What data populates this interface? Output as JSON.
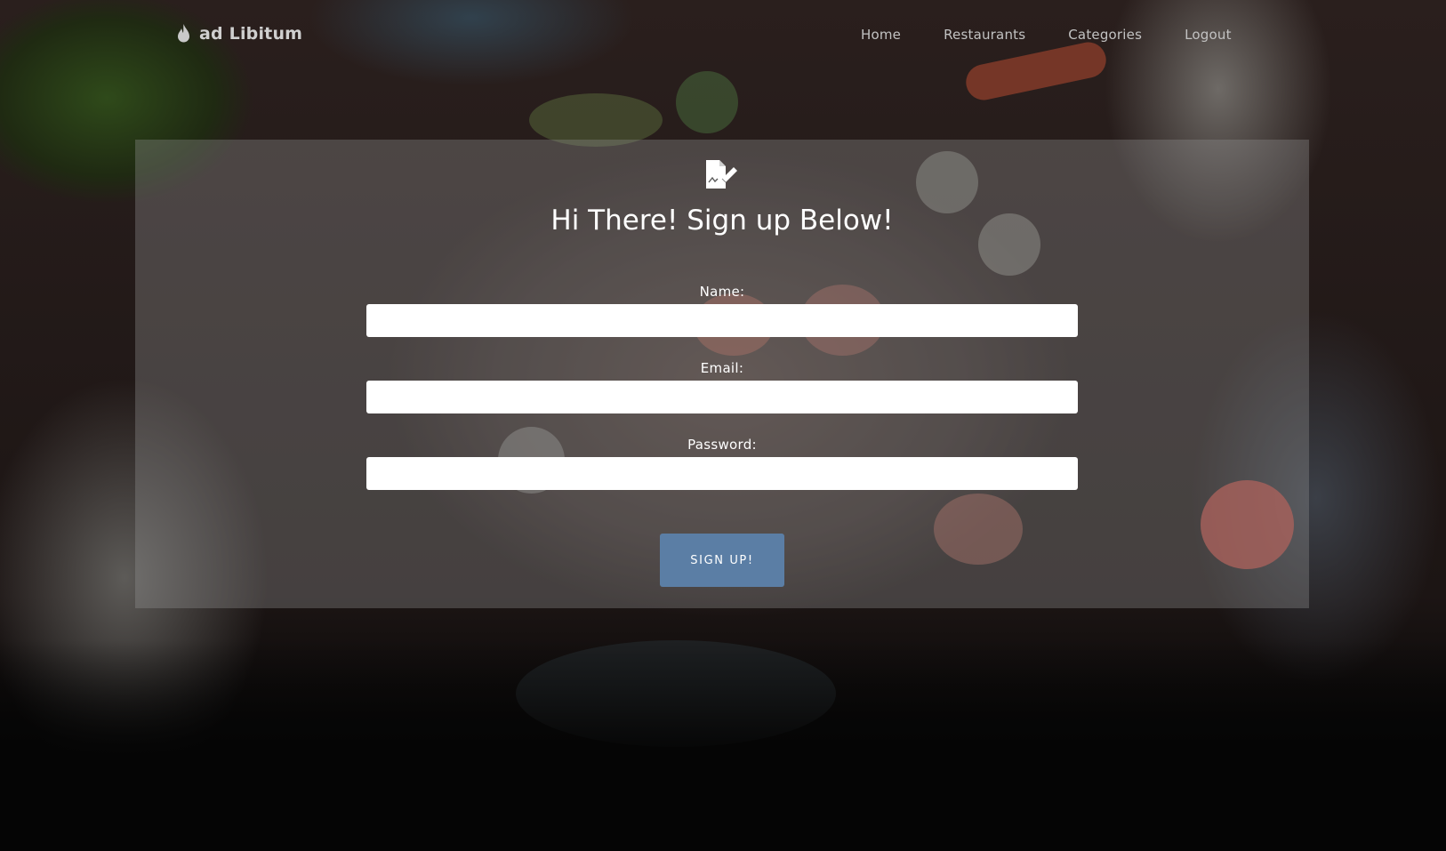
{
  "nav": {
    "brand": "ad Libitum",
    "brand_icon": "flame-icon",
    "links": [
      "Home",
      "Restaurants",
      "Categories",
      "Logout"
    ]
  },
  "form": {
    "icon": "signature-document-icon",
    "title": "Hi There! Sign up Below!",
    "fields": [
      {
        "label": "Name:",
        "value": ""
      },
      {
        "label": "Email:",
        "value": ""
      },
      {
        "label": "Password:",
        "value": ""
      }
    ],
    "submit_label": "SIGN UP!"
  },
  "colors": {
    "button": "#5b7ea5",
    "panel": "rgba(150,150,150,0.34)",
    "text": "#ffffff"
  }
}
